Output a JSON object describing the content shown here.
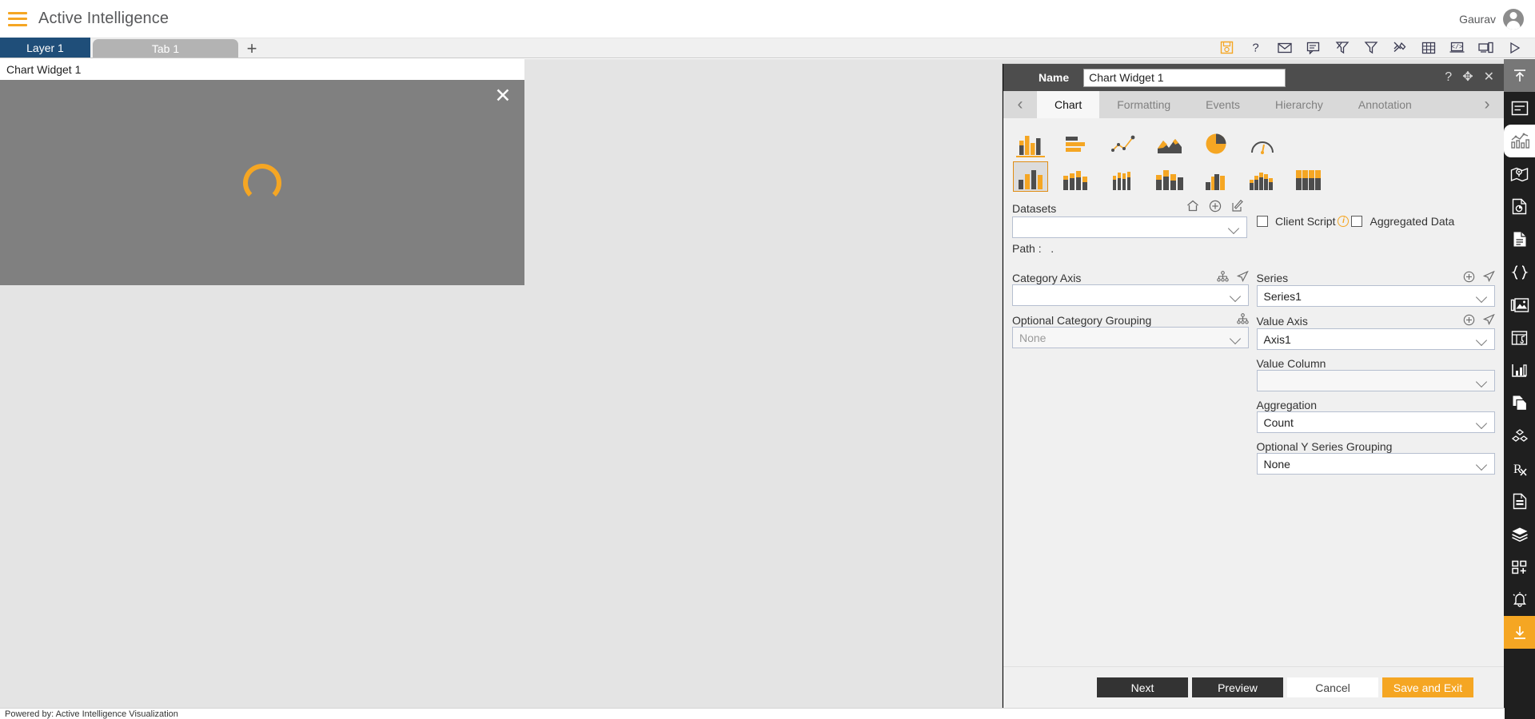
{
  "appbar": {
    "menu_icon": "hamburger-icon",
    "title": "Active Intelligence",
    "user_name": "Gaurav",
    "avatar_icon": "user-avatar-icon"
  },
  "tabstrip": {
    "layer_label": "Layer 1",
    "tab_label": "Tab 1",
    "add_label": "+",
    "icons": [
      "save-report-icon",
      "help-icon",
      "mail-icon",
      "comment-icon",
      "clear-filter-icon",
      "filter-icon",
      "tools-icon",
      "table-icon",
      "code-icon",
      "responsive-icon",
      "play-icon"
    ]
  },
  "widget": {
    "title": "Chart Widget 1",
    "close_label": "✕",
    "loading": "loading-spinner"
  },
  "panel": {
    "name_label": "Name",
    "name_value": "Chart Widget 1",
    "name_placeholder": "Chart Widget 1",
    "header_icons": [
      "help-icon",
      "move-icon",
      "close-icon"
    ],
    "prev_arrow": "‹",
    "next_arrow": "›",
    "tabs": [
      {
        "label": "Chart",
        "active": true
      },
      {
        "label": "Formatting",
        "active": false
      },
      {
        "label": "Events",
        "active": false
      },
      {
        "label": "Hierarchy",
        "active": false
      },
      {
        "label": "Annotation",
        "active": false
      }
    ],
    "chart_types": [
      {
        "name": "column-chart-icon",
        "selected": true
      },
      {
        "name": "bar-chart-icon",
        "selected": false
      },
      {
        "name": "scatter-line-chart-icon",
        "selected": false
      },
      {
        "name": "area-chart-icon",
        "selected": false
      },
      {
        "name": "pie-chart-icon",
        "selected": false
      },
      {
        "name": "gauge-chart-icon",
        "selected": false
      }
    ],
    "chart_subtypes": [
      {
        "name": "clustered-column-icon",
        "selected": true
      },
      {
        "name": "stacked-column-icon",
        "selected": false
      },
      {
        "name": "thin-column-icon",
        "selected": false
      },
      {
        "name": "grouped-stacked-column-icon",
        "selected": false
      },
      {
        "name": "overlapped-column-icon",
        "selected": false
      },
      {
        "name": "multi-series-column-icon",
        "selected": false
      },
      {
        "name": "full-stacked-column-icon",
        "selected": false
      }
    ],
    "datasets": {
      "label": "Datasets",
      "icons": [
        "home-icon",
        "add-icon",
        "edit-icon"
      ],
      "value": "",
      "path_label": "Path :",
      "path_value": "."
    },
    "options": {
      "client_script_label": "Client Script",
      "client_script_checked": false,
      "client_script_info": "info-icon",
      "aggregated_data_label": "Aggregated Data",
      "aggregated_data_checked": false
    },
    "category_axis": {
      "label": "Category Axis",
      "value": "",
      "icons": [
        "hierarchy-icon",
        "send-icon"
      ]
    },
    "optional_category_grouping": {
      "label": "Optional Category Grouping",
      "value": "None",
      "icons": [
        "hierarchy-icon"
      ]
    },
    "series": {
      "label": "Series",
      "value": "Series1",
      "icons": [
        "add-icon",
        "send-icon"
      ]
    },
    "value_axis": {
      "label": "Value Axis",
      "value": "Axis1",
      "icons": [
        "add-icon",
        "send-icon"
      ]
    },
    "value_column": {
      "label": "Value Column",
      "value": ""
    },
    "aggregation": {
      "label": "Aggregation",
      "value": "Count"
    },
    "optional_y_series_grouping": {
      "label": "Optional Y Series Grouping",
      "value": "None"
    },
    "footer": {
      "next": "Next",
      "preview": "Preview",
      "cancel": "Cancel",
      "save_exit": "Save and Exit"
    }
  },
  "rail": {
    "items": [
      {
        "name": "collapse-up-icon",
        "state": "top"
      },
      {
        "name": "widget-layout-icon",
        "state": "normal"
      },
      {
        "name": "chart-widget-icon",
        "state": "active"
      },
      {
        "name": "map-widget-icon",
        "state": "normal"
      },
      {
        "name": "report-widget-icon",
        "state": "normal"
      },
      {
        "name": "document-widget-icon",
        "state": "normal"
      },
      {
        "name": "code-widget-icon",
        "state": "normal"
      },
      {
        "name": "image-widget-icon",
        "state": "normal"
      },
      {
        "name": "media-widget-icon",
        "state": "normal"
      },
      {
        "name": "kpi-widget-icon",
        "state": "normal"
      },
      {
        "name": "copy-widget-icon",
        "state": "normal"
      },
      {
        "name": "cube-widget-icon",
        "state": "normal"
      },
      {
        "name": "prescription-widget-icon",
        "state": "normal"
      },
      {
        "name": "form-widget-icon",
        "state": "normal"
      },
      {
        "name": "layers-widget-icon",
        "state": "normal"
      },
      {
        "name": "add-group-icon",
        "state": "normal"
      },
      {
        "name": "alert-bell-icon",
        "state": "normal"
      },
      {
        "name": "download-icon",
        "state": "accent"
      }
    ]
  },
  "statusbar": {
    "text": "Powered by: Active Intelligence Visualization"
  },
  "colors": {
    "accent": "#f5a623",
    "layer_tab": "#1f4e79",
    "panel_header": "#4d4d4d",
    "rail": "#1f1f1f",
    "widget_body": "#808080"
  }
}
